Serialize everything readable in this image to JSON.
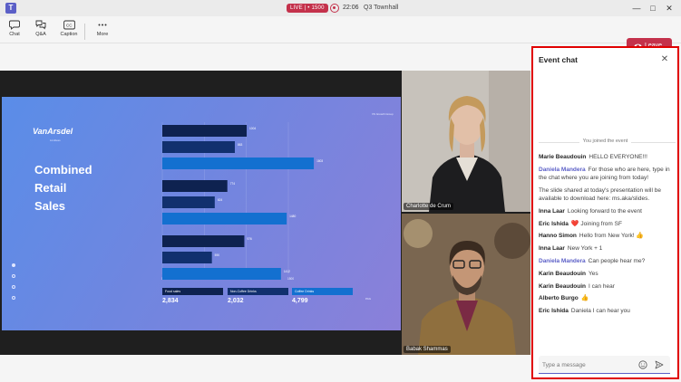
{
  "window": {
    "title": "Q3 Townhall",
    "live_label": "LIVE | • 1500",
    "timer": "22:06",
    "logo_glyph": "T"
  },
  "toolbar": {
    "items": [
      {
        "label": "Chat",
        "icon": "chat-icon"
      },
      {
        "label": "Q&A",
        "icon": "qa-icon"
      },
      {
        "label": "Caption",
        "icon": "caption-icon"
      },
      {
        "label": "More",
        "icon": "more-icon"
      }
    ],
    "leave_label": "Leave"
  },
  "slide": {
    "logo": "VanArsdel",
    "logo_sub": "Limitless",
    "tag": "VS Growth Group",
    "title": "Combined\nRetail\nSales",
    "page": "PAG",
    "stats": [
      {
        "label": "Food sales",
        "value": "2,834"
      },
      {
        "label": "Non-Coffee Drinks",
        "value": "2,032"
      },
      {
        "label": "Coffee Drinks",
        "value": "4,799"
      }
    ]
  },
  "chart_data": {
    "type": "bar",
    "orientation": "horizontal",
    "xlim": [
      0,
      1500
    ],
    "x_ticks": [
      "0",
      "500",
      "1000",
      "1500"
    ],
    "groups": [
      {
        "values": [
          1004,
          863,
          1803
        ],
        "labels": [
          "1004",
          "863",
          "1803"
        ]
      },
      {
        "values": [
          774,
          624,
          1480
        ],
        "labels": [
          "774",
          "624",
          "1480"
        ]
      },
      {
        "values": [
          976,
          590,
          1412
        ],
        "labels": [
          "976",
          "590",
          "1412"
        ]
      }
    ],
    "colors": [
      "#0e2250",
      "#11306e",
      "#1370d0"
    ]
  },
  "participants": [
    {
      "name": "Charlotte de Crum"
    },
    {
      "name": "Babak Shammas"
    }
  ],
  "chat": {
    "title": "Event chat",
    "system_message": "You joined the event",
    "messages": [
      {
        "sender": "Marie Beaudouin",
        "text": "HELLO EVERYONE!!!",
        "purple": false
      },
      {
        "sender": "Daniela Mandera",
        "text": "For those who are here, type in the chat where you are joining from today!",
        "purple": true
      },
      {
        "sender": "",
        "text": "The slide shared at today's presentation will be available to download here: ms.aka/slides.",
        "purple": false
      },
      {
        "sender": "Inna Laar",
        "text": "Looking forward to the event",
        "purple": false
      },
      {
        "sender": "Eric Ishida",
        "emoji": "❤️",
        "text": "Joining from SF",
        "purple": false
      },
      {
        "sender": "Hanno Simon",
        "text": "Hello from New York!",
        "emoji_after": "👍",
        "purple": false
      },
      {
        "sender": "Inna Laar",
        "text": "New York + 1",
        "purple": false
      },
      {
        "sender": "Daniela Mandera",
        "text": "Can people hear me?",
        "purple": true
      },
      {
        "sender": "Karin Beaudouin",
        "text": "Yes",
        "purple": false
      },
      {
        "sender": "Karin Beaudouin",
        "text": "I can hear",
        "purple": false
      },
      {
        "sender": "Alberto Burgo",
        "emoji": "👍",
        "text": "",
        "purple": false
      },
      {
        "sender": "Eric Ishida",
        "text": "Daniela I can hear you",
        "purple": false
      }
    ],
    "compose_placeholder": "Type a message"
  },
  "colors": {
    "accent": "#5b5fc7",
    "leave": "#c4314b",
    "highlight_border": "#e00000"
  }
}
